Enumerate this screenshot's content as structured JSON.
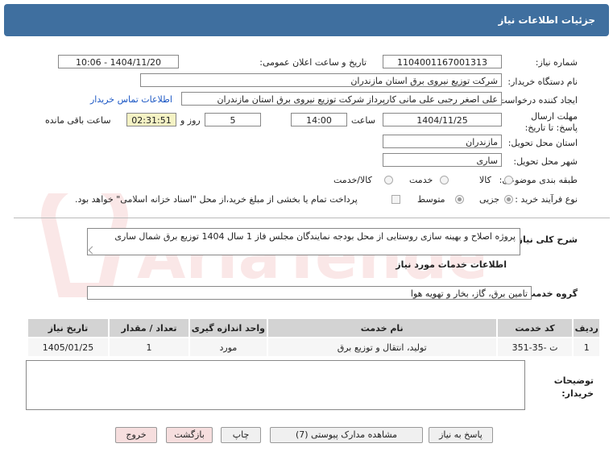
{
  "header": {
    "title": "جزئیات اطلاعات نیاز"
  },
  "form": {
    "need_number": {
      "label": "شماره نیاز:",
      "value": "1104001167001313"
    },
    "announce": {
      "label": "تاریخ و ساعت اعلان عمومی:",
      "value": "1404/11/20 - 10:06"
    },
    "buyer_org": {
      "label": "نام دستگاه خریدار:",
      "value": "شرکت توزیع نیروی برق استان مازندران"
    },
    "creator": {
      "label": "ایجاد کننده درخواست:",
      "value": "علی اصغر رجبی علی مانی کارپرداز شرکت توزیع نیروی برق استان مازندران",
      "contact_link": "اطلاعات تماس خریدار"
    },
    "deadline": {
      "label": "مهلت ارسال پاسخ: تا تاریخ:",
      "date": "1404/11/25",
      "time_label": "ساعت",
      "time": "14:00",
      "days": "5",
      "days_label": "روز و",
      "remaining": "02:31:51",
      "remaining_label": "ساعت باقی مانده"
    },
    "province": {
      "label": "استان محل تحویل:",
      "value": "مازندران"
    },
    "city": {
      "label": "شهر محل تحویل:",
      "value": "ساری"
    },
    "category": {
      "label": "طبقه بندی موضوعی:",
      "options": [
        "کالا",
        "خدمت",
        "کالا/خدمت"
      ]
    },
    "purchase_type": {
      "label": "نوع فرآیند خرید :",
      "options": [
        "جزیی",
        "متوسط"
      ],
      "payment_note": "پرداخت تمام یا بخشی از مبلغ خرید،از محل \"اسناد خزانه اسلامی\" خواهد بود."
    }
  },
  "description": {
    "label": "شرح کلی نیاز:",
    "value": "پروژه اصلاح و بهینه سازی روستایی از محل بودجه نمایندگان مجلس فاز 1 سال 1404 توزیع برق شمال ساری"
  },
  "services": {
    "section_title": "اطلاعات خدمات مورد نیاز",
    "group_label": "گروه خدمت:",
    "group_value": "تامین برق، گاز، بخار و تهویه هوا",
    "columns": [
      "ردیف",
      "کد خدمت",
      "نام خدمت",
      "واحد اندازه گیری",
      "تعداد / مقدار",
      "تاریخ نیاز"
    ],
    "rows": [
      {
        "index": "1",
        "code": "ت -35-351",
        "name": "تولید، انتقال و توزیع برق",
        "unit": "مورد",
        "qty": "1",
        "date": "1405/01/25"
      }
    ]
  },
  "buyer_notes": {
    "label_line1": "توضیحات",
    "label_line2": "خریدار:",
    "value": ""
  },
  "buttons": {
    "reply": "پاسخ به نیاز",
    "attachments": "مشاهده مدارک پیوستی (7)",
    "print": "چاپ",
    "back": "بازگشت",
    "exit": "خروج"
  },
  "watermark": {
    "text": "AriaTender.net"
  }
}
